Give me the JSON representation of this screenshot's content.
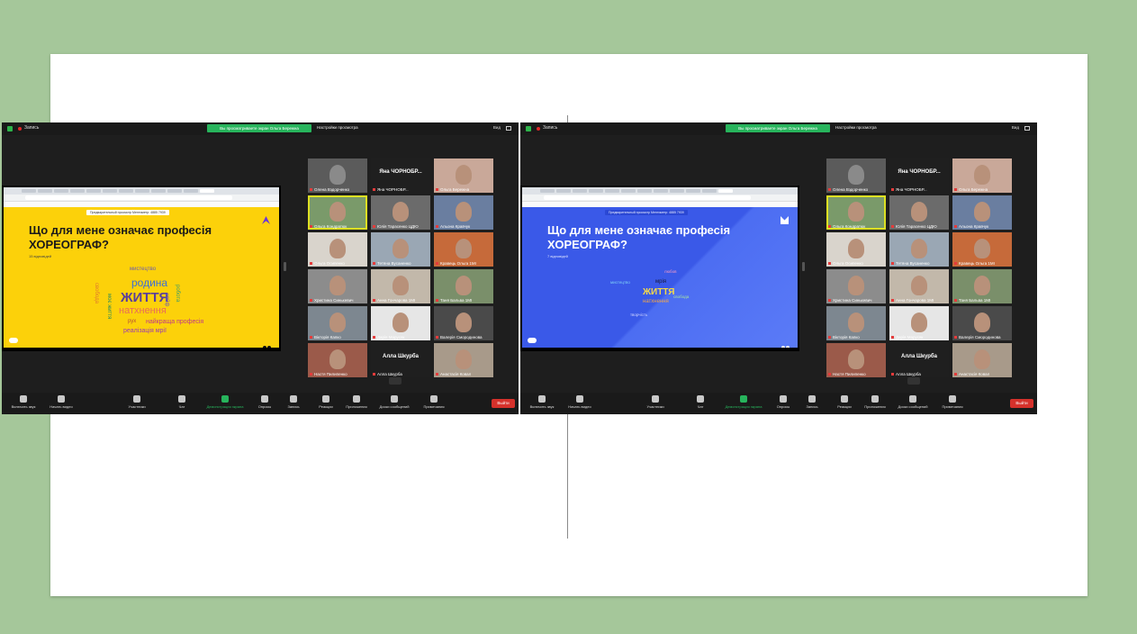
{
  "panels": [
    {
      "side": "left",
      "record_label": "Запись",
      "share_banner": "Вы просматриваете экран Ольга Бережна",
      "view_options": "Настройки просмотра",
      "view_label": "Вид",
      "presentation_banner": "Предварительный просмотр Ментиметр: 4885 7939",
      "question_title": "Що для мене означає професія ХОРЕОГРАФ?",
      "question_sub": "15 відповідей",
      "word_cloud": [
        {
          "text": "ЖИТТЯ",
          "color": "#5a3e9b"
        },
        {
          "text": "натхнення",
          "color": "#e86c5a"
        },
        {
          "text": "родина",
          "color": "#3c6fd6"
        },
        {
          "text": "мистецтво",
          "color": "#6b5bb3"
        },
        {
          "text": "найкраща професія",
          "color": "#c0398a"
        },
        {
          "text": "реалізація мрії",
          "color": "#9b3bb3"
        },
        {
          "text": "свобода",
          "color": "#e07a2e"
        },
        {
          "text": "моє життя",
          "color": "#2c8c5a"
        },
        {
          "text": "рух",
          "color": "#b34b3b"
        },
        {
          "text": "робота",
          "color": "#3b9b6b"
        },
        {
          "text": "кайф",
          "color": "#6b5bb3"
        }
      ]
    },
    {
      "side": "right",
      "record_label": "Запись",
      "share_banner": "Вы просматриваете экран Ольга Бережна",
      "view_options": "Настройки просмотра",
      "view_label": "Вид",
      "presentation_banner": "Предварительный просмотр Ментиметр: 4885 7939",
      "question_title": "Що для мене означає професія ХОРЕОГРАФ?",
      "question_sub": "7 відповідей",
      "word_cloud": [
        {
          "text": "ЖИТТЯ",
          "color": "#f5d94a"
        },
        {
          "text": "натхнення",
          "color": "#f2a64a"
        },
        {
          "text": "мрія",
          "color": "#1a1a3a"
        },
        {
          "text": "мистецтво",
          "color": "#7fd1f5"
        },
        {
          "text": "любов",
          "color": "#f59ac7"
        },
        {
          "text": "свобода",
          "color": "#a7e3a0"
        },
        {
          "text": "творчість",
          "color": "#cfd5ff"
        }
      ]
    }
  ],
  "participants": [
    {
      "name": "Олена Вздорченко",
      "initial_name": ""
    },
    {
      "name": "Яна ЧОРНОБР...",
      "initial_name": "Яна ЧОРНОБР..."
    },
    {
      "name": "Ольга Бережна",
      "initial_name": ""
    },
    {
      "name": "Ольга Кондратюк",
      "initial_name": ""
    },
    {
      "name": "Юлія Тарасенко ЦДЮ",
      "initial_name": ""
    },
    {
      "name": "Альона Кравчук",
      "initial_name": ""
    },
    {
      "name": "Ольга Осипенко",
      "initial_name": ""
    },
    {
      "name": "Тетяна Вусаненко",
      "initial_name": ""
    },
    {
      "name": "Кравець Ольга 1МІ",
      "initial_name": ""
    },
    {
      "name": "Христина Синькевич",
      "initial_name": ""
    },
    {
      "name": "Анна Гончарова 1МІ",
      "initial_name": ""
    },
    {
      "name": "Таня Бальва 1МІ",
      "initial_name": ""
    },
    {
      "name": "Вікторія Капко",
      "initial_name": ""
    },
    {
      "name": "Дарія Марусяк",
      "initial_name": ""
    },
    {
      "name": "Валерія Смородинова",
      "initial_name": ""
    },
    {
      "name": "Настя Пилипенко",
      "initial_name": ""
    },
    {
      "name": "Алла Шкурба",
      "initial_name": "Алла Шкурба"
    },
    {
      "name": "Анастасія Ковал",
      "initial_name": ""
    }
  ],
  "toolbar": {
    "mute": "Включить звук",
    "video": "Начать видео",
    "participants": "Участники",
    "participants_count": "21",
    "chat": "Чат",
    "share": "Демонстрация экрана",
    "poll": "Опросы",
    "record": "Запись",
    "reactions": "Реакции",
    "apps": "Приложения",
    "whiteboard": "Доски сообщений",
    "notes": "Примечания",
    "leave": "Выйти"
  },
  "colors": {
    "background": "#a5c79a",
    "zoom_dark": "#1e1e1e",
    "zoom_green": "#27b45c",
    "leave_red": "#d5312b",
    "menti_yellow": "#fcd10a",
    "menti_blue": "#3a59e8"
  }
}
